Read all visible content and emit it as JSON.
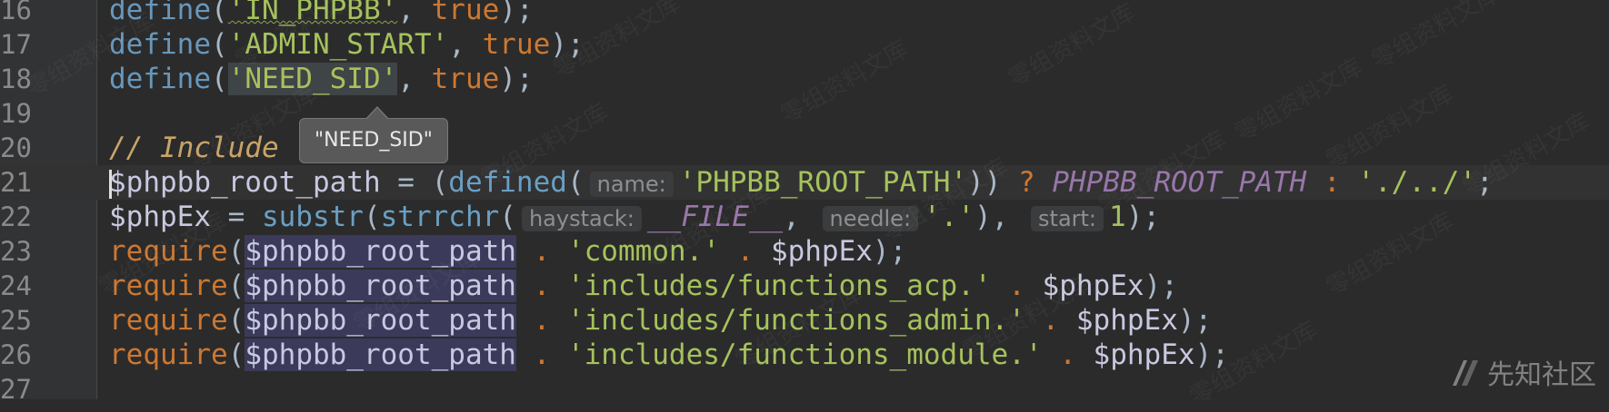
{
  "editor": {
    "lines": [
      {
        "num": "16",
        "segments": [
          {
            "t": "define",
            "c": "fn"
          },
          {
            "t": "(",
            "c": "plain"
          },
          {
            "t": "'IN_PHPBB'",
            "c": "str squiggle"
          },
          {
            "t": ", ",
            "c": "plain"
          },
          {
            "t": "true",
            "c": "kw"
          },
          {
            "t": ");",
            "c": "plain"
          }
        ]
      },
      {
        "num": "17",
        "segments": [
          {
            "t": "define",
            "c": "fn"
          },
          {
            "t": "(",
            "c": "plain"
          },
          {
            "t": "'ADMIN_START'",
            "c": "str"
          },
          {
            "t": ", ",
            "c": "plain"
          },
          {
            "t": "true",
            "c": "kw"
          },
          {
            "t": ");",
            "c": "plain"
          }
        ]
      },
      {
        "num": "18",
        "segments": [
          {
            "t": "define",
            "c": "fn"
          },
          {
            "t": "(",
            "c": "plain"
          },
          {
            "t": "'NEED_SID'",
            "c": "str-hl"
          },
          {
            "t": ", ",
            "c": "plain"
          },
          {
            "t": "true",
            "c": "kw"
          },
          {
            "t": ");",
            "c": "plain"
          }
        ]
      },
      {
        "num": "19",
        "segments": []
      },
      {
        "num": "20",
        "segments": [
          {
            "t": "// Include",
            "c": "cmt"
          }
        ]
      },
      {
        "num": "21",
        "current": true,
        "segments": [
          {
            "t": "$phpbb_root_path",
            "c": "var caretstart"
          },
          {
            "t": " = (",
            "c": "plain"
          },
          {
            "t": "defined",
            "c": "fn2"
          },
          {
            "t": "(",
            "c": "plain"
          },
          {
            "t": "name:",
            "c": "hint"
          },
          {
            "t": "'PHPBB_ROOT_PATH'",
            "c": "str"
          },
          {
            "t": ")) ",
            "c": "plain"
          },
          {
            "t": "? ",
            "c": "op"
          },
          {
            "t": "PHPBB_ROOT_PATH",
            "c": "const"
          },
          {
            "t": " : ",
            "c": "op"
          },
          {
            "t": "'./../'",
            "c": "str"
          },
          {
            "t": ";",
            "c": "plain"
          }
        ]
      },
      {
        "num": "22",
        "segments": [
          {
            "t": "$phpEx",
            "c": "var"
          },
          {
            "t": " = ",
            "c": "plain"
          },
          {
            "t": "substr",
            "c": "fn2"
          },
          {
            "t": "(",
            "c": "plain"
          },
          {
            "t": "strrchr",
            "c": "fn2"
          },
          {
            "t": "(",
            "c": "plain"
          },
          {
            "t": "haystack:",
            "c": "hint"
          },
          {
            "t": "__FILE__",
            "c": "const"
          },
          {
            "t": ", ",
            "c": "plain"
          },
          {
            "t": "needle:",
            "c": "hint"
          },
          {
            "t": "'.'",
            "c": "str"
          },
          {
            "t": "), ",
            "c": "plain"
          },
          {
            "t": "start:",
            "c": "hint"
          },
          {
            "t": "1",
            "c": "str"
          },
          {
            "t": ");",
            "c": "plain"
          }
        ]
      },
      {
        "num": "23",
        "segments": [
          {
            "t": "require",
            "c": "kw"
          },
          {
            "t": "(",
            "c": "plain"
          },
          {
            "t": "$phpbb_root_path",
            "c": "var-hl"
          },
          {
            "t": " . ",
            "c": "op"
          },
          {
            "t": "'common.'",
            "c": "str"
          },
          {
            "t": " . ",
            "c": "op"
          },
          {
            "t": "$phpEx",
            "c": "var"
          },
          {
            "t": ");",
            "c": "plain"
          }
        ]
      },
      {
        "num": "24",
        "segments": [
          {
            "t": "require",
            "c": "kw"
          },
          {
            "t": "(",
            "c": "plain"
          },
          {
            "t": "$phpbb_root_path",
            "c": "var-hl"
          },
          {
            "t": " . ",
            "c": "op"
          },
          {
            "t": "'includes/functions_acp.'",
            "c": "str"
          },
          {
            "t": " . ",
            "c": "op"
          },
          {
            "t": "$phpEx",
            "c": "var"
          },
          {
            "t": ");",
            "c": "plain"
          }
        ]
      },
      {
        "num": "25",
        "segments": [
          {
            "t": "require",
            "c": "kw"
          },
          {
            "t": "(",
            "c": "plain"
          },
          {
            "t": "$phpbb_root_path",
            "c": "var-hl"
          },
          {
            "t": " . ",
            "c": "op"
          },
          {
            "t": "'includes/functions_admin.'",
            "c": "str"
          },
          {
            "t": " . ",
            "c": "op"
          },
          {
            "t": "$phpEx",
            "c": "var"
          },
          {
            "t": ");",
            "c": "plain"
          }
        ]
      },
      {
        "num": "26",
        "segments": [
          {
            "t": "require",
            "c": "kw"
          },
          {
            "t": "(",
            "c": "plain"
          },
          {
            "t": "$phpbb_root_path",
            "c": "var-hl"
          },
          {
            "t": " . ",
            "c": "op"
          },
          {
            "t": "'includes/functions_module.'",
            "c": "str"
          },
          {
            "t": " . ",
            "c": "op"
          },
          {
            "t": "$phpEx",
            "c": "var"
          },
          {
            "t": ");",
            "c": "plain"
          }
        ]
      },
      {
        "num": "27",
        "segments": []
      }
    ]
  },
  "tooltip": {
    "text": "\"NEED_SID\""
  },
  "watermark": {
    "text": "零组资料文库"
  },
  "logo": {
    "text": "先知社区",
    "icon": "xianzhi-logo-icon"
  },
  "colors": {
    "background": "#2b2b2b",
    "string": "#a5c25c",
    "keyword": "#cc7832",
    "function": "#6897bb",
    "constant": "#9876aa"
  }
}
